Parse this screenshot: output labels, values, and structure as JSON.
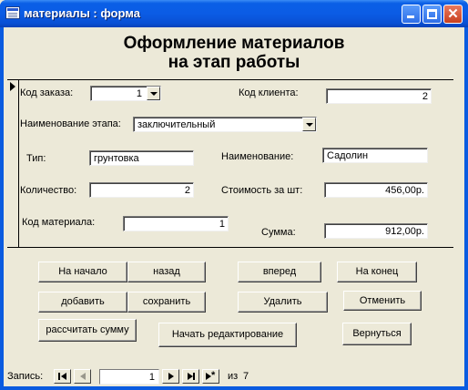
{
  "window": {
    "title": "материалы : форма"
  },
  "form": {
    "heading": "Оформление материалов\nна этап работы",
    "order_code": {
      "label": "Код заказа:",
      "value": "1"
    },
    "client_code": {
      "label": "Код клиента:",
      "value": "2"
    },
    "stage_name": {
      "label": "Наименование этапа:",
      "value": "заключительный"
    },
    "type": {
      "label": "Тип:",
      "value": "грунтовка"
    },
    "name": {
      "label": "Наименование:",
      "value": "Садолин"
    },
    "quantity": {
      "label": "Количество:",
      "value": "2"
    },
    "unit_cost": {
      "label": "Стоимость за шт:",
      "value": "456,00р."
    },
    "material_code": {
      "label": "Код материала:",
      "value": "1"
    },
    "sum": {
      "label": "Сумма:",
      "value": "912,00р."
    }
  },
  "buttons": {
    "first": "На начало",
    "back": "назад",
    "forward": "вперед",
    "last": "На конец",
    "add": "добавить",
    "save": "сохранить",
    "delete": "Удалить",
    "cancel": "Отменить",
    "calc_sum": "рассчитать сумму",
    "start_edit": "Начать редактирование",
    "return": "Вернуться"
  },
  "navigator": {
    "label": "Запись:",
    "current": "1",
    "of_label": "из",
    "total": "7"
  },
  "icons": {
    "window_icon": "form-icon",
    "minimize": "minimize-icon",
    "maximize": "maximize-icon",
    "close": "close-icon"
  }
}
